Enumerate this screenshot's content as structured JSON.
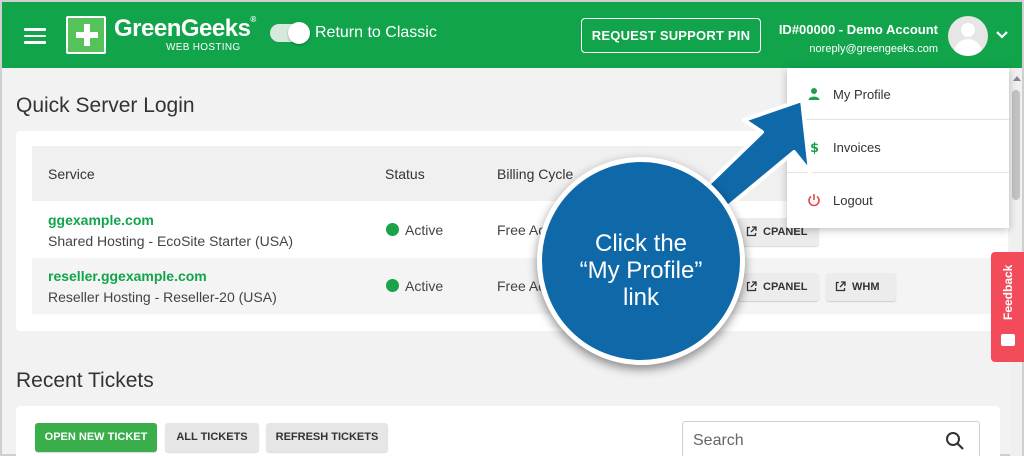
{
  "colors": {
    "brand_green": "#11a44b",
    "callout_blue": "#0f68a8",
    "feedback_red": "#f24c5a",
    "active_green": "#1aa34a"
  },
  "header": {
    "logo_name": "GreenGeeks",
    "logo_reg": "®",
    "logo_sub": "WEB HOSTING",
    "toggle_label": "Return to Classic",
    "support_pin_label": "REQUEST SUPPORT PIN",
    "account_id": "ID#00000 - Demo Account",
    "account_email": "noreply@greengeeks.com"
  },
  "dropdown": {
    "items": [
      {
        "label": "My Profile",
        "icon": "person-icon"
      },
      {
        "label": "Invoices",
        "icon": "dollar-icon"
      },
      {
        "label": "Logout",
        "icon": "power-icon"
      }
    ]
  },
  "quick_login": {
    "title": "Quick Server Login",
    "columns": [
      "Service",
      "Status",
      "Billing Cycle"
    ],
    "rows": [
      {
        "name": "ggexample.com",
        "desc": "Shared Hosting - EcoSite Starter (USA)",
        "status": "Active",
        "cycle": "Free Ac",
        "buttons": [
          "CPANEL"
        ]
      },
      {
        "name": "reseller.ggexample.com",
        "desc": "Reseller Hosting - Reseller-20 (USA)",
        "status": "Active",
        "cycle": "Free Ac",
        "buttons": [
          "CPANEL",
          "WHM"
        ]
      }
    ]
  },
  "recent_tickets": {
    "title": "Recent Tickets",
    "buttons": [
      "OPEN NEW TICKET",
      "ALL TICKETS",
      "REFRESH TICKETS"
    ],
    "search_placeholder": "Search"
  },
  "callout": {
    "line1": "Click the",
    "line2": "“My Profile”",
    "line3": "link"
  },
  "feedback_label": "Feedback"
}
